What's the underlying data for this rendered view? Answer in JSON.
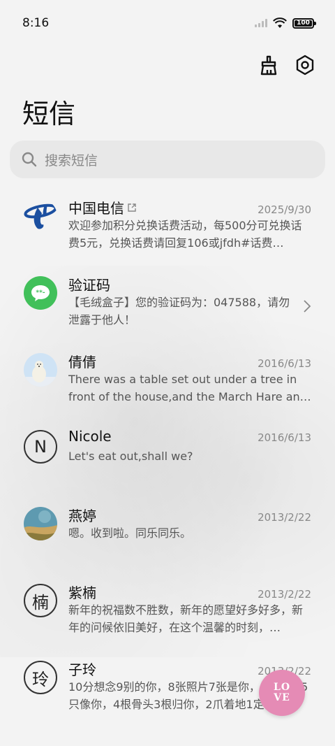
{
  "status_bar": {
    "time": "8:16",
    "battery": "100"
  },
  "toolbar": {
    "clean_icon": "broom-icon",
    "settings_icon": "hex-gear-icon"
  },
  "page_title": "短信",
  "search": {
    "placeholder": "搜索短信"
  },
  "conversations": [
    {
      "name": "中国电信",
      "date": "2025/9/30",
      "preview": "欢迎参加积分兑换话费活动，每500分可兑换话费5元，兑换话费请回复106或jfdh#话费…",
      "avatar": "china-telecom-logo"
    },
    {
      "name": "验证码",
      "date": "",
      "preview": "【毛绒盒子】您的验证码为：047588，请勿泄露于他人！",
      "avatar": "message-bubble-icon"
    },
    {
      "name": "倩倩",
      "date": "2016/6/13",
      "preview": "There was a table set out under a tree in front of the house,and the March Hare an…",
      "avatar": "polar-bear-photo"
    },
    {
      "name": "Nicole",
      "date": "2016/6/13",
      "preview": "Let's eat out,shall we?",
      "avatar_letter": "N"
    },
    {
      "name": "燕婷",
      "date": "2013/2/22",
      "preview": "嗯。收到啦。同乐同乐。",
      "avatar": "landscape-photo"
    },
    {
      "name": "紫楠",
      "date": "2013/2/22",
      "preview": "新年的祝福数不胜数，新年的愿望好多好多，新年的问候依旧美好，在这个温馨的时刻，…",
      "avatar_letter": "楠"
    },
    {
      "name": "子玲",
      "date": "2013/2/22",
      "preview": "10分想念9别的你，8张照片7张是你，6只小狗5只像你，4根骨头3根归你，2爪着地1定…",
      "avatar_letter": "玲"
    }
  ],
  "fab": {
    "line1": "LO",
    "line2": "VE",
    "color": "#e58bb5"
  }
}
